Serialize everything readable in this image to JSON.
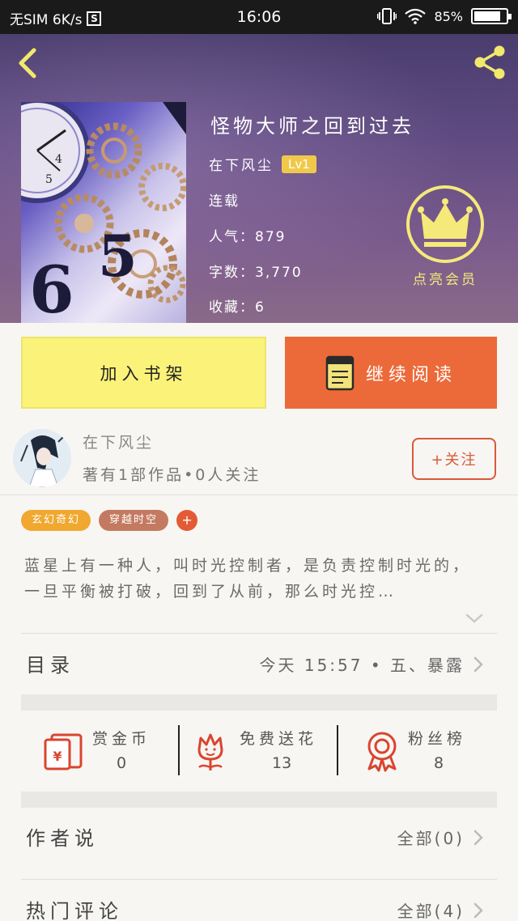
{
  "status_bar": {
    "carrier": "无SIM 6K/s",
    "sim_badge": "S",
    "time": "16:06",
    "battery": "85%",
    "battery_level": 0.85
  },
  "book": {
    "title": "怪物大师之回到过去",
    "author": "在下风尘",
    "level": "Lv1",
    "status": "连载",
    "popularity": "人气：879",
    "word_count": "字数：3,770",
    "favorites": "收藏：6",
    "vip_label": "点亮会员"
  },
  "actions": {
    "add_shelf": "加入书架",
    "continue_reading": "继续阅读"
  },
  "author_card": {
    "name": "在下风尘",
    "meta": "著有1部作品•0人关注",
    "follow": "+关注"
  },
  "tags": [
    {
      "label": "玄幻奇幻",
      "color": "#f0a830"
    },
    {
      "label": "穿越时空",
      "color": "#c47a60"
    }
  ],
  "tag_add": "+",
  "synopsis": "蓝星上有一种人，叫时光控制者，是负责控制时光的，一旦平衡被打破，回到了从前，那么时光控…",
  "catalog": {
    "title": "目录",
    "latest": "今天 15:57 • 五、暴露"
  },
  "stats": [
    {
      "label": "赏金币",
      "value": "0"
    },
    {
      "label": "免费送花",
      "value": "13"
    },
    {
      "label": "粉丝榜",
      "value": "8"
    }
  ],
  "author_says": {
    "title": "作者说",
    "link": "全部(0)"
  },
  "hot_comments": {
    "title": "热门评论",
    "link": "全部(4)"
  },
  "colors": {
    "accent_orange": "#ec6a39",
    "accent_yellow": "#fbf279",
    "icon_red": "#d9452f"
  }
}
